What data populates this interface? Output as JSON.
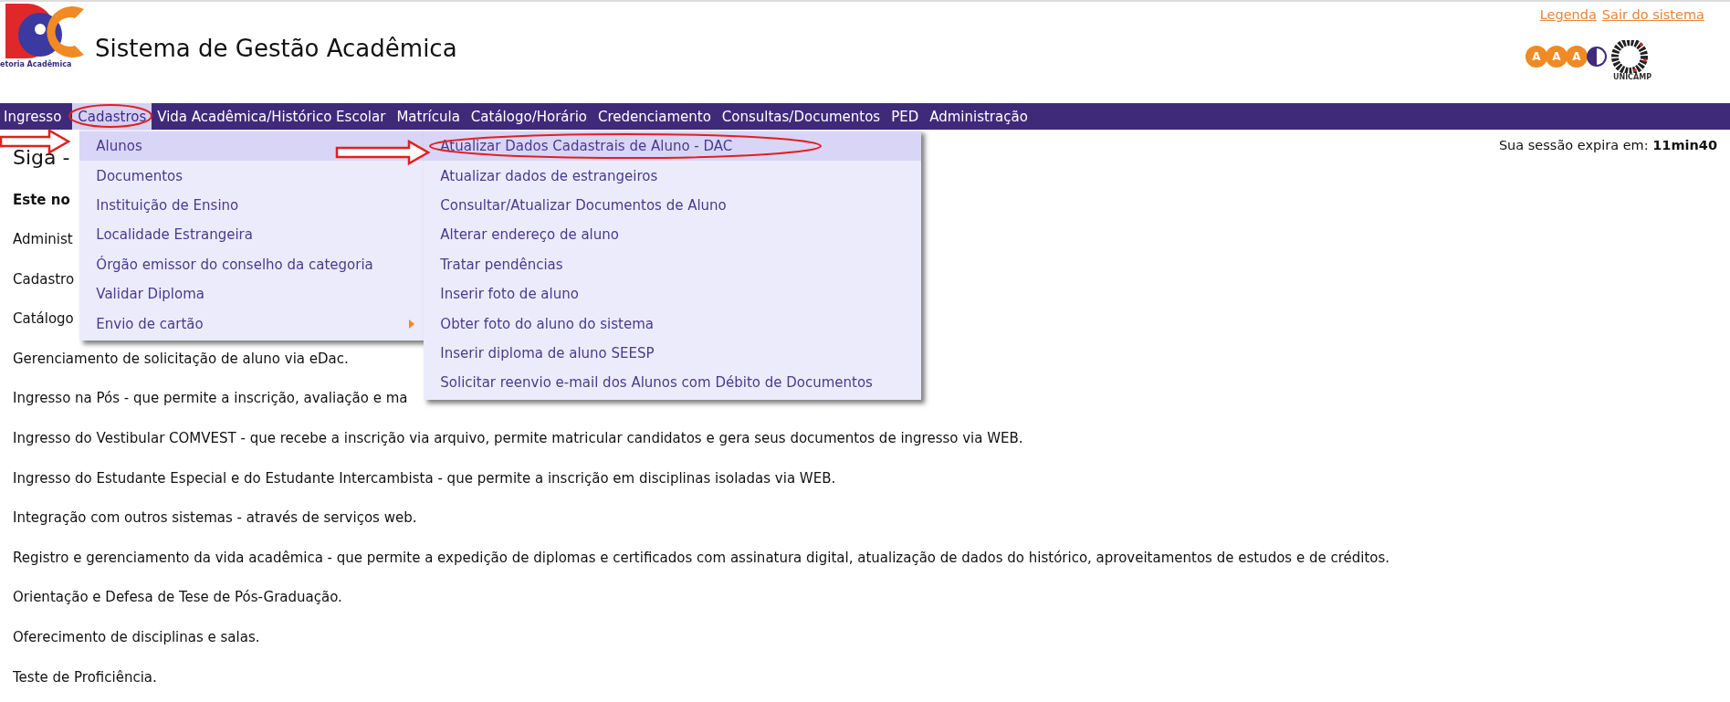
{
  "header": {
    "logo_caption": "etoria Acadêmica",
    "title": "Sistema de Gestão Acadêmica",
    "links": [
      "Legenda",
      "Sair do sistema"
    ],
    "partner_logo": {
      "letters": [
        "A",
        "A",
        "A"
      ],
      "caption": "UNICAMP"
    }
  },
  "menu": [
    {
      "label": "Ingresso",
      "selected": false
    },
    {
      "label": "Cadastros",
      "selected": true,
      "children": [
        {
          "label": "Alunos",
          "selected": true,
          "children": [
            {
              "label": "Atualizar Dados Cadastrais de Aluno - DAC",
              "selected": true
            },
            {
              "label": "Atualizar dados de estrangeiros",
              "selected": false
            },
            {
              "label": "Consultar/Atualizar Documentos de Aluno",
              "selected": false
            },
            {
              "label": "Alterar endereço de aluno",
              "selected": false
            },
            {
              "label": "Tratar pendências",
              "selected": false
            },
            {
              "label": "Inserir foto de aluno",
              "selected": false
            },
            {
              "label": "Obter foto do aluno do sistema",
              "selected": false
            },
            {
              "label": "Inserir diploma de aluno SEESP",
              "selected": false
            },
            {
              "label": "Solicitar reenvio e-mail dos Alunos com Débito de Documentos",
              "selected": false
            }
          ]
        },
        {
          "label": "Documentos",
          "selected": false
        },
        {
          "label": "Instituição de Ensino",
          "selected": false
        },
        {
          "label": "Localidade Estrangeira",
          "selected": false
        },
        {
          "label": "Órgão emissor do conselho da categoria",
          "selected": false
        },
        {
          "label": "Validar Diploma",
          "selected": false
        },
        {
          "label": "Envio de cartão",
          "selected": false,
          "has_submenu": true
        }
      ]
    },
    {
      "label": "Vida Acadêmica/Histórico Escolar",
      "selected": false
    },
    {
      "label": "Matrícula",
      "selected": false
    },
    {
      "label": "Catálogo/Horário",
      "selected": false
    },
    {
      "label": "Credenciamento",
      "selected": false
    },
    {
      "label": "Consultas/Documentos",
      "selected": false
    },
    {
      "label": "PED",
      "selected": false
    },
    {
      "label": "Administração",
      "selected": false
    }
  ],
  "session": {
    "label": "Sua sessão expira em:",
    "time": "11min40"
  },
  "content": {
    "heading": "Siga -",
    "intro": "Este no",
    "items": [
      "Administ",
      "Cadastro",
      "Catálogo",
      "Gerenciamento de solicitação de aluno via eDac.",
      "Ingresso na Pós - que permite a inscrição, avaliação e ma",
      "Ingresso do Vestibular COMVEST - que recebe a inscrição via arquivo, permite matricular candidatos e gera seus documentos de ingresso via WEB.",
      "Ingresso do Estudante Especial e do Estudante Intercambista - que permite a inscrição em disciplinas isoladas via WEB.",
      "Integração com outros sistemas - através de serviços web.",
      "Registro e gerenciamento da vida acadêmica - que permite a expedição de diplomas e certificados com assinatura digital, atualização de dados do histórico, aproveitamentos de estudos e de créditos.",
      "Orientação e Defesa de Tese de Pós-Graduação.",
      "Oferecimento de disciplinas e salas.",
      "Teste de Proficiência."
    ]
  }
}
